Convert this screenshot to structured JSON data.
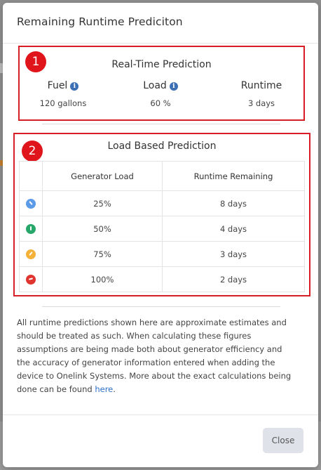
{
  "modal": {
    "title": "Remaining Runtime Prediciton"
  },
  "realtime": {
    "badge": "1",
    "title": "Real-Time Prediction",
    "fuel": {
      "label": "Fuel",
      "value": "120 gallons",
      "info_icon": "info-icon"
    },
    "load": {
      "label": "Load",
      "value": "60 %",
      "info_icon": "info-icon"
    },
    "runtime": {
      "label": "Runtime",
      "value": "3 days"
    }
  },
  "load_based": {
    "badge": "2",
    "title": "Load Based Prediction",
    "headers": [
      "Generator Load",
      "Runtime Remaining"
    ],
    "rows": [
      {
        "load": "25%",
        "runtime": "8 days",
        "icon": "gauge-low-icon",
        "color": "#5b9be8"
      },
      {
        "load": "50%",
        "runtime": "4 days",
        "icon": "gauge-medium-icon",
        "color": "#27a86a"
      },
      {
        "load": "75%",
        "runtime": "3 days",
        "icon": "gauge-high-icon",
        "color": "#f5b23b"
      },
      {
        "load": "100%",
        "runtime": "2 days",
        "icon": "gauge-max-icon",
        "color": "#e0352f"
      }
    ]
  },
  "disclaimer": {
    "text": "All runtime predictions shown here are approximate estimates and should be treated as such. When calculating these figures assumptions are being made both about generator efficiency and the accuracy of generator information entered when adding the device to Onelink Systems. More about the exact calculations being done can be found ",
    "link_text": "here",
    "suffix": "."
  },
  "footer": {
    "close_label": "Close"
  },
  "colors": {
    "highlight": "#d61f26",
    "badge": "#e0141b",
    "info": "#3d6fb4",
    "link": "#2f6fc9"
  }
}
